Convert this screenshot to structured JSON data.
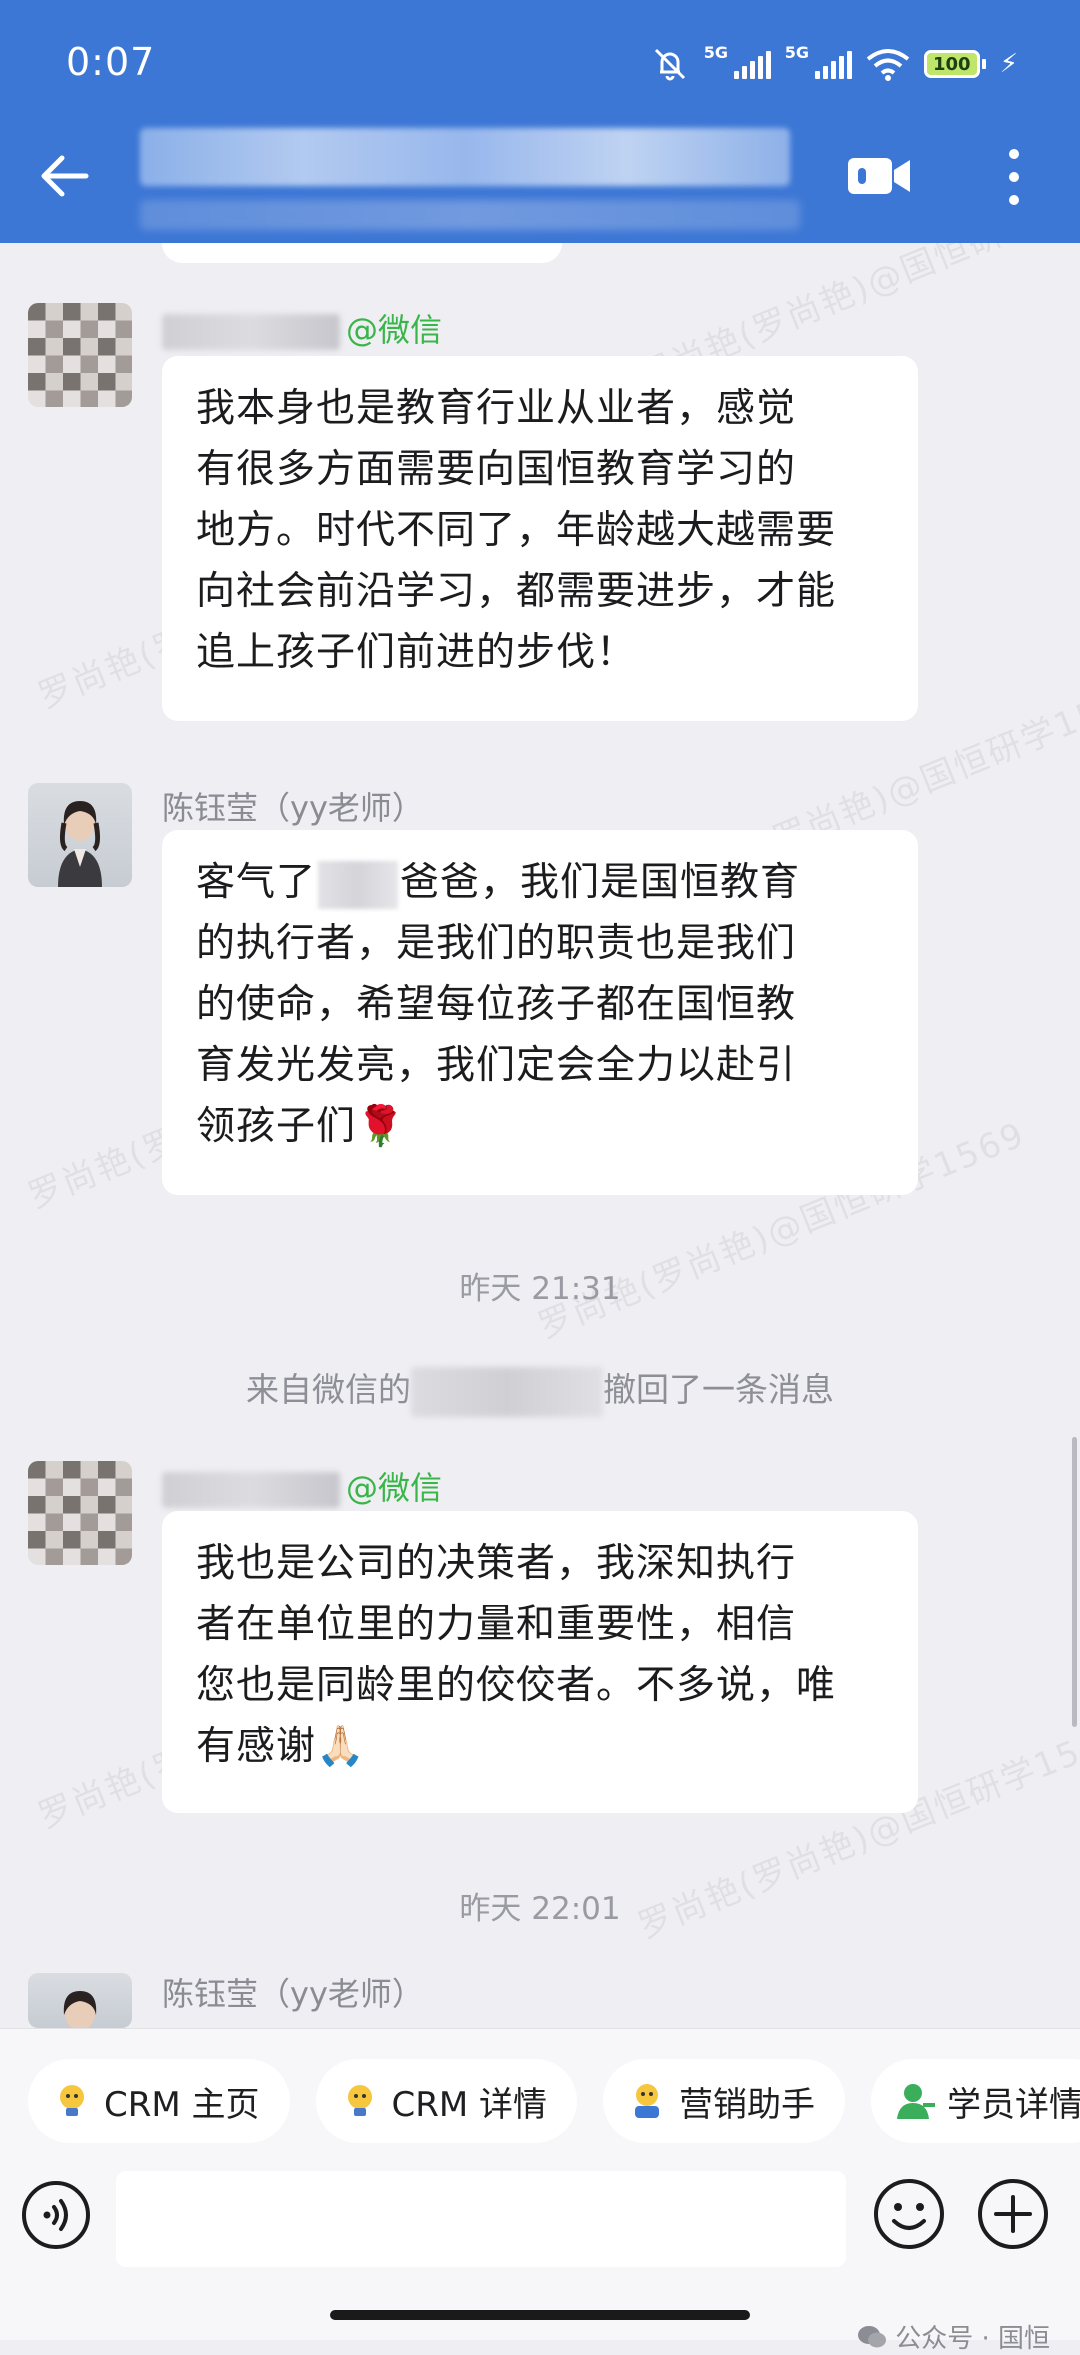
{
  "status_bar": {
    "time": "0:07",
    "network_1": "5G",
    "network_2": "5G",
    "battery": "100"
  },
  "header": {
    "title_hidden": true
  },
  "messages": [
    {
      "type": "incoming",
      "sender_suffix": "@微信",
      "lines": [
        "我本身也是教育行业从业者，感觉",
        "有很多方面需要向国恒教育学习的",
        "地方。时代不同了，年龄越大越需要",
        "向社会前沿学习，都需要进步，才能",
        "追上孩子们前进的步伐！"
      ]
    },
    {
      "type": "incoming",
      "sender": "陈钰莹（yy老师）",
      "line1_prefix": "客气了",
      "line1_suffix": "爸爸，我们是国恒教育",
      "lines": [
        "的执行者，是我们的职责也是我们",
        "的使命，希望每位孩子都在国恒教",
        "育发光发亮，我们定会全力以赴引"
      ],
      "last_line": "领孩子们",
      "emoji": "🌹"
    },
    {
      "type": "incoming",
      "sender_suffix": "@微信",
      "lines": [
        "我也是公司的决策者，我深知执行",
        "者在单位里的力量和重要性，相信",
        "您也是同龄里的佼佼者。不多说，唯"
      ],
      "last_line": "有感谢",
      "emoji": "🙏🏻"
    }
  ],
  "system": {
    "time_1": "昨天  21:31",
    "recall_prefix": "来自微信的",
    "recall_suffix": "撤回了一条消息",
    "time_2": "昨天  22:01",
    "last_sender": "陈钰莹（yy老师）"
  },
  "toolbar": {
    "chips": [
      "CRM 主页",
      "CRM 详情",
      "营销助手",
      "学员详情"
    ],
    "input_placeholder": ""
  },
  "watermark": {
    "text": "罗尚艳(罗尚艳)@国恒研学1569"
  },
  "account_mark": {
    "text": "公众号 · 国恒"
  },
  "colors": {
    "header": "#3d77d5",
    "chat_bg": "#efeff3",
    "wechat_green": "#39b54a"
  }
}
